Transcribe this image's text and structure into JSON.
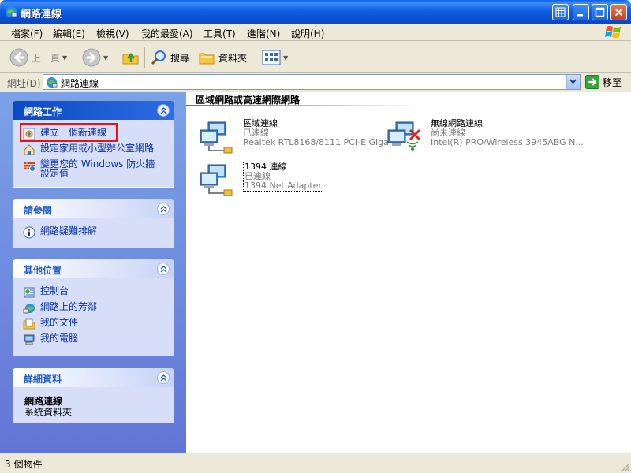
{
  "window": {
    "title": "網路連線"
  },
  "menu": {
    "items": [
      "檔案(F)",
      "編輯(E)",
      "檢視(V)",
      "我的最愛(A)",
      "工具(T)",
      "進階(N)",
      "說明(H)"
    ]
  },
  "toolbar": {
    "back_label": "上一頁",
    "search_label": "搜尋",
    "folders_label": "資料夾"
  },
  "address": {
    "label": "網址(D)",
    "value": "網路連線",
    "go_label": "移至"
  },
  "taskpane": {
    "network_tasks": {
      "title": "網路工作",
      "items": [
        {
          "label": "建立一個新連線"
        },
        {
          "label": "設定家用或小型辦公室網路"
        },
        {
          "label": "變更您的 Windows 防火牆設定值"
        }
      ]
    },
    "see_also": {
      "title": "請參閱",
      "items": [
        {
          "label": "網路疑難排解"
        }
      ]
    },
    "other_places": {
      "title": "其他位置",
      "items": [
        {
          "label": "控制台"
        },
        {
          "label": "網路上的芳鄰"
        },
        {
          "label": "我的文件"
        },
        {
          "label": "我的電腦"
        }
      ]
    },
    "details": {
      "title": "詳細資料",
      "name": "網路連線",
      "type": "系統資料夾"
    }
  },
  "content": {
    "group_title": "區域網路或高速網際網路",
    "connections": [
      {
        "name": "區域連線",
        "status": "已連線",
        "device": "Realtek RTL8168/8111 PCI-E Giga..."
      },
      {
        "name": "無線網路連線",
        "status": "尚未連線",
        "device": "Intel(R) PRO/Wireless 3945ABG N..."
      },
      {
        "name": "1394 連線",
        "status": "已連線",
        "device": "1394 Net Adapter"
      }
    ]
  },
  "status": {
    "text": "3 個物件"
  },
  "colors": {
    "title_bar": "#0b4fd0",
    "task_link": "#0c32a4",
    "highlight": "#e3151a"
  }
}
